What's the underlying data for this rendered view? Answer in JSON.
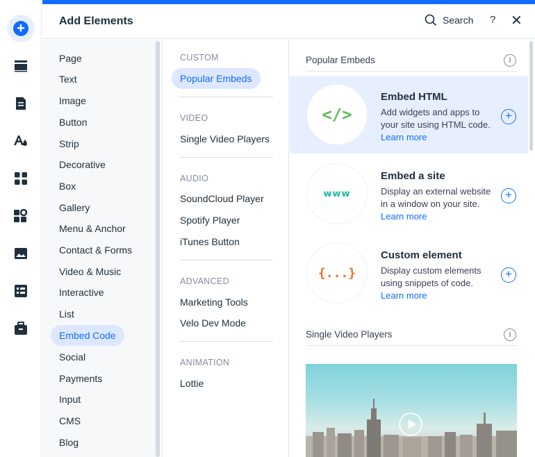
{
  "panel": {
    "title": "Add Elements",
    "search_label": "Search",
    "help_label": "?",
    "close_label": "✕"
  },
  "rail": {
    "icons": [
      "add-icon",
      "sections-icon",
      "pages-icon",
      "theme-icon",
      "apps-icon",
      "business-icon",
      "media-icon",
      "cms-icon",
      "portfolio-icon"
    ]
  },
  "categories": [
    "Page",
    "Text",
    "Image",
    "Button",
    "Strip",
    "Decorative",
    "Box",
    "Gallery",
    "Menu & Anchor",
    "Contact & Forms",
    "Video & Music",
    "Interactive",
    "List",
    "Embed Code",
    "Social",
    "Payments",
    "Input",
    "CMS",
    "Blog"
  ],
  "active_category": "Embed Code",
  "subcategories": {
    "custom": {
      "label": "CUSTOM",
      "items": [
        "Popular Embeds"
      ]
    },
    "video": {
      "label": "VIDEO",
      "items": [
        "Single Video Players"
      ]
    },
    "audio": {
      "label": "AUDIO",
      "items": [
        "SoundCloud Player",
        "Spotify Player",
        "iTunes Button"
      ]
    },
    "advanced": {
      "label": "ADVANCED",
      "items": [
        "Marketing Tools",
        "Velo Dev Mode"
      ]
    },
    "animation": {
      "label": "ANIMATION",
      "items": [
        "Lottie"
      ]
    }
  },
  "content": {
    "popular_title": "Popular Embeds",
    "info_label": "i",
    "plus_label": "+",
    "learn_more": "Learn more",
    "cards": [
      {
        "title": "Embed HTML",
        "desc": "Add widgets and apps to your site using HTML code.",
        "icon_text": "</>",
        "icon_color": "#60bc57"
      },
      {
        "title": "Embed a site",
        "desc": "Display an external website in a window on your site.",
        "icon_text": "www",
        "icon_color": "#1cb7a6"
      },
      {
        "title": "Custom element",
        "desc": "Display custom elements using snippets of code.",
        "icon_text": "{...}",
        "icon_color": "#f06c24"
      }
    ],
    "video_title": "Single Video Players"
  },
  "colors": {
    "accent": "#116dff",
    "selected_bg": "#dde7ff"
  }
}
